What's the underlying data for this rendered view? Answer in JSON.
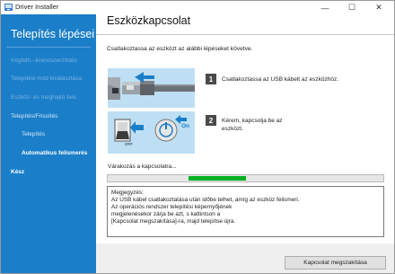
{
  "window": {
    "title": "Driver Installer",
    "minimize_glyph": "—",
    "maximize_glyph": "☐",
    "close_glyph": "✕"
  },
  "sidebar": {
    "title": "Telepítés lépései",
    "steps": [
      {
        "label": "Végfelh.–licencszerződés",
        "state": "disabled"
      },
      {
        "label": "Telepítési mód kiválasztása",
        "state": "disabled"
      },
      {
        "label": "Eszköz- és meghajtó bek.",
        "state": "disabled"
      },
      {
        "label": "Telepítés/Frissítés",
        "state": "done"
      },
      {
        "label": "Telepítés",
        "state": "done"
      },
      {
        "label": "Automatikus felismerés",
        "state": "active"
      },
      {
        "label": "Kész",
        "state": "pending"
      }
    ]
  },
  "main": {
    "title": "Eszközkapcsolat",
    "instruction": "Csatlakoztassa az eszközt az alábbi lépéseket követve.",
    "steps": [
      {
        "number": "1",
        "text": "Csatlakoztassa az USB kábelt az eszközhöz."
      },
      {
        "number": "2",
        "text_lines": [
          "Kérem, kapcsolja be az",
          "eszközt."
        ]
      }
    ],
    "illustration_labels": {
      "on": "On",
      "off": "OFF"
    },
    "waiting_label": "Várakozás a kapcsolatra...",
    "progress": {
      "segment_start": 0.29,
      "segment_end": 0.5,
      "fill_color": "#06b025"
    },
    "note_lines": [
      "Megjegyzés:",
      "Az USB kábel csatlakoztatása után időbe telhet, amíg az eszköz felismeri.",
      "Az operációs rendszer telepítési képernyőjének",
      "megjelenésekor zárja be azt, s kattintson a",
      "[Kapcsolat megszakítása]-ra, majd telepítse újra."
    ]
  },
  "footer": {
    "cancel_button": "Kapcsolat megszakítása"
  },
  "colors": {
    "sidebar_bg": "#1b7ec9",
    "illustration_bg": "#bedff3",
    "accent_blue": "#1b7ec9"
  },
  "icons": {
    "app": "installer-icon",
    "usb": "usb-plug-icon",
    "power_switch": "power-switch-icon",
    "power_button": "power-button-icon"
  }
}
